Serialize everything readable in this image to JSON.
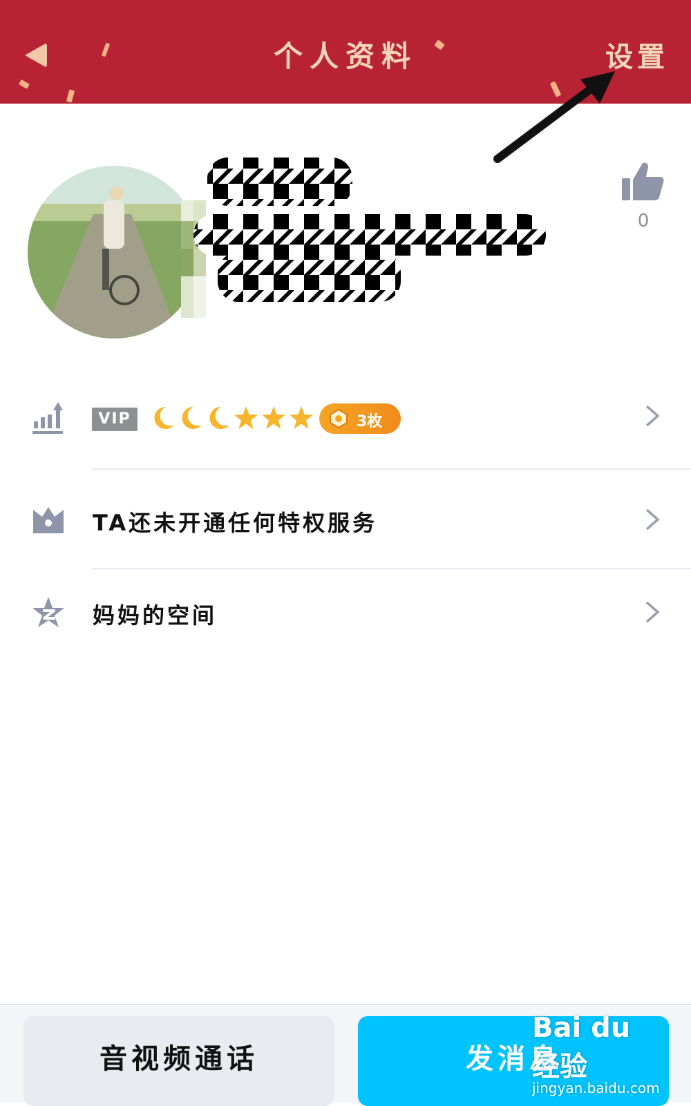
{
  "header": {
    "title": "个人资料",
    "settings_label": "设置",
    "background_color": "#b72334",
    "text_color": "#f6d5b8"
  },
  "profile": {
    "like_count": "0"
  },
  "rows": [
    {
      "id": "level",
      "vip_label": "VIP",
      "level_icons": [
        "moon",
        "moon",
        "moon",
        "star",
        "star",
        "star"
      ],
      "badge_label": "3枚"
    },
    {
      "id": "privilege",
      "label": "TA还未开通任何特权服务"
    },
    {
      "id": "space",
      "label": "妈妈的空间"
    }
  ],
  "buttons": {
    "call_label": "音视频通话",
    "message_label": "发消息"
  },
  "watermark": {
    "main": "Bai du 经验",
    "sub": "jingyan.baidu.com"
  },
  "colors": {
    "accent": "#00c3ff",
    "badge": "#f5a623",
    "icon_gray": "#8e95a9"
  }
}
